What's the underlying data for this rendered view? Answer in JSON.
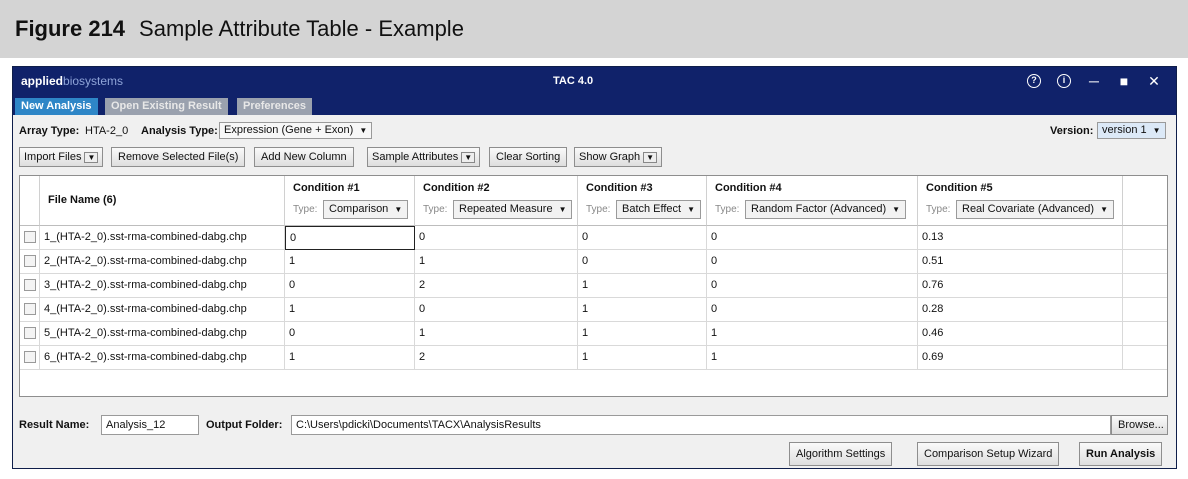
{
  "figure": {
    "number": "Figure 214",
    "caption": "Sample Attribute Table - Example"
  },
  "app": {
    "brand_bold": "applied",
    "brand_light": "biosystems",
    "title": "TAC 4.0",
    "window_icons": [
      "help-icon",
      "info-icon",
      "minimize-icon",
      "maximize-icon",
      "close-icon"
    ]
  },
  "tabs": [
    {
      "label": "New Analysis",
      "active": true
    },
    {
      "label": "Open Existing Result",
      "active": false
    },
    {
      "label": "Preferences",
      "active": false
    }
  ],
  "options": {
    "array_type_label": "Array Type:",
    "array_type_value": "HTA-2_0",
    "analysis_type_label": "Analysis Type:",
    "analysis_type_value": "Expression (Gene + Exon)",
    "version_label": "Version:",
    "version_value": "version 1"
  },
  "toolbar": {
    "import_files": "Import Files",
    "remove_selected": "Remove Selected File(s)",
    "add_column": "Add New Column",
    "sample_attributes": "Sample Attributes",
    "clear_sorting": "Clear Sorting",
    "show_graph": "Show Graph"
  },
  "grid": {
    "file_header": "File Name (6)",
    "type_label": "Type:",
    "conditions": [
      {
        "title": "Condition #1",
        "type": "Comparison"
      },
      {
        "title": "Condition #2",
        "type": "Repeated Measure"
      },
      {
        "title": "Condition #3",
        "type": "Batch Effect"
      },
      {
        "title": "Condition #4",
        "type": "Random Factor (Advanced)"
      },
      {
        "title": "Condition #5",
        "type": "Real Covariate (Advanced)"
      }
    ],
    "rows": [
      {
        "file": "1_(HTA-2_0).sst-rma-combined-dabg.chp",
        "values": [
          "0",
          "0",
          "0",
          "0",
          "0.13"
        ]
      },
      {
        "file": "2_(HTA-2_0).sst-rma-combined-dabg.chp",
        "values": [
          "1",
          "1",
          "0",
          "0",
          "0.51"
        ]
      },
      {
        "file": "3_(HTA-2_0).sst-rma-combined-dabg.chp",
        "values": [
          "0",
          "2",
          "1",
          "0",
          "0.76"
        ]
      },
      {
        "file": "4_(HTA-2_0).sst-rma-combined-dabg.chp",
        "values": [
          "1",
          "0",
          "1",
          "0",
          "0.28"
        ]
      },
      {
        "file": "5_(HTA-2_0).sst-rma-combined-dabg.chp",
        "values": [
          "0",
          "1",
          "1",
          "1",
          "0.46"
        ]
      },
      {
        "file": "6_(HTA-2_0).sst-rma-combined-dabg.chp",
        "values": [
          "1",
          "2",
          "1",
          "1",
          "0.69"
        ]
      }
    ]
  },
  "footer": {
    "result_name_label": "Result Name:",
    "result_name_value": "Analysis_12",
    "output_folder_label": "Output Folder:",
    "output_folder_value": "C:\\Users\\pdicki\\Documents\\TACX\\AnalysisResults",
    "browse": "Browse...",
    "algorithm_settings": "Algorithm Settings",
    "comparison_wizard": "Comparison Setup Wizard",
    "run_analysis": "Run Analysis"
  },
  "colors": {
    "titlebar": "#10226a",
    "active_tab": "#2e86c7",
    "inactive_tab": "#9aa1ae",
    "caption_band": "#d4d4d4"
  }
}
